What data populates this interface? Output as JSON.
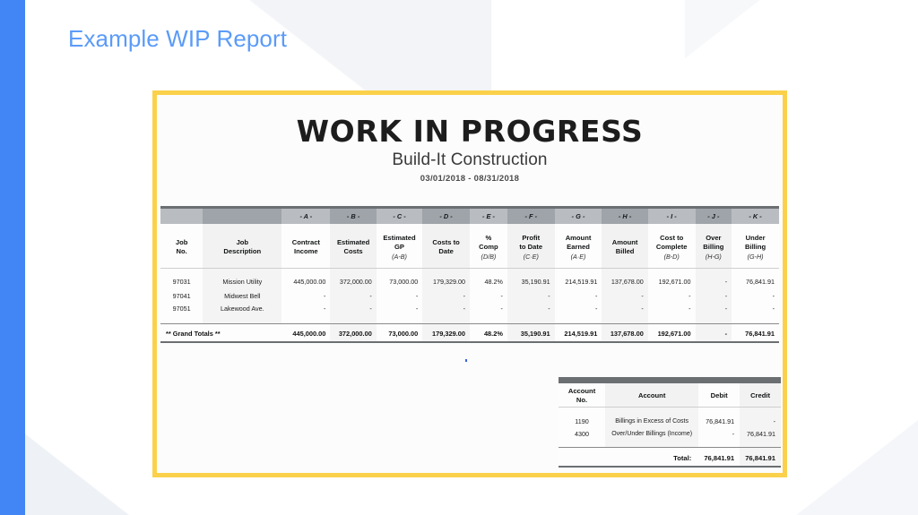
{
  "slide": {
    "title": "Example WIP Report",
    "accent_color": "#4285f4",
    "title_color": "#5b9bf8",
    "frame_color": "#fbd14b"
  },
  "report": {
    "title": "WORK IN PROGRESS",
    "company": "Build-It Construction",
    "period": "03/01/2018 - 08/31/2018",
    "column_letters": [
      "- A -",
      "- B -",
      "- C -",
      "- D -",
      "- E -",
      "- F -",
      "- G -",
      "- H -",
      "- I -",
      "- J -",
      "- K -"
    ],
    "headers": [
      {
        "line1": "Job",
        "line2": "No.",
        "formula": ""
      },
      {
        "line1": "Job",
        "line2": "Description",
        "formula": ""
      },
      {
        "line1": "Contract",
        "line2": "Income",
        "formula": ""
      },
      {
        "line1": "Estimated",
        "line2": "Costs",
        "formula": ""
      },
      {
        "line1": "Estimated",
        "line2": "GP",
        "formula": "(A-B)"
      },
      {
        "line1": "Costs to",
        "line2": "Date",
        "formula": ""
      },
      {
        "line1": "%",
        "line2": "Comp",
        "formula": "(D/B)"
      },
      {
        "line1": "Profit",
        "line2": "to Date",
        "formula": "(C·E)"
      },
      {
        "line1": "Amount",
        "line2": "Earned",
        "formula": "(A·E)"
      },
      {
        "line1": "Amount",
        "line2": "Billed",
        "formula": ""
      },
      {
        "line1": "Cost to",
        "line2": "Complete",
        "formula": "(B-D)"
      },
      {
        "line1": "Over",
        "line2": "Billing",
        "formula": "(H-G)"
      },
      {
        "line1": "Under",
        "line2": "Billing",
        "formula": "(G-H)"
      }
    ],
    "rows": [
      {
        "job_no": "97031",
        "description": "Mission Utility",
        "contract_income": "445,000.00",
        "estimated_costs": "372,000.00",
        "estimated_gp": "73,000.00",
        "costs_to_date": "179,329.00",
        "pct_comp": "48.2%",
        "profit_to_date": "35,190.91",
        "amount_earned": "214,519.91",
        "amount_billed": "137,678.00",
        "cost_to_complete": "192,671.00",
        "over_billing": "-",
        "under_billing": "76,841.91"
      },
      {
        "job_no": "97041",
        "description": "Midwest Bell",
        "contract_income": "-",
        "estimated_costs": "-",
        "estimated_gp": "-",
        "costs_to_date": "-",
        "pct_comp": "-",
        "profit_to_date": "-",
        "amount_earned": "-",
        "amount_billed": "-",
        "cost_to_complete": "-",
        "over_billing": "-",
        "under_billing": "-"
      },
      {
        "job_no": "97051",
        "description": "Lakewood Ave.",
        "contract_income": "-",
        "estimated_costs": "-",
        "estimated_gp": "-",
        "costs_to_date": "-",
        "pct_comp": "-",
        "profit_to_date": "-",
        "amount_earned": "-",
        "amount_billed": "-",
        "cost_to_complete": "-",
        "over_billing": "-",
        "under_billing": "-"
      }
    ],
    "totals": {
      "label": "** Grand Totals **",
      "contract_income": "445,000.00",
      "estimated_costs": "372,000.00",
      "estimated_gp": "73,000.00",
      "costs_to_date": "179,329.00",
      "pct_comp": "48.2%",
      "profit_to_date": "35,190.91",
      "amount_earned": "214,519.91",
      "amount_billed": "137,678.00",
      "cost_to_complete": "192,671.00",
      "over_billing": "-",
      "under_billing": "76,841.91"
    }
  },
  "journal": {
    "headers": {
      "account_no_l1": "Account",
      "account_no_l2": "No.",
      "account": "Account",
      "debit": "Debit",
      "credit": "Credit"
    },
    "rows": [
      {
        "account_no": "1190",
        "account": "Billings in Excess of Costs",
        "debit": "76,841.91",
        "credit": "-"
      },
      {
        "account_no": "4300",
        "account": "Over/Under Billings (Income)",
        "debit": "-",
        "credit": "76,841.91"
      }
    ],
    "total": {
      "label": "Total:",
      "debit": "76,841.91",
      "credit": "76,841.91"
    }
  }
}
